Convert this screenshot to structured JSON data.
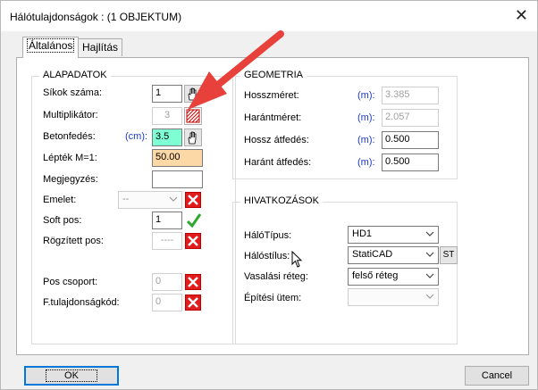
{
  "window": {
    "title": "Hálótulajdonságok : (1 OBJEKTUM)"
  },
  "tabs": [
    {
      "label": "Általános"
    },
    {
      "label": "Hajlítás"
    }
  ],
  "alapadatok": {
    "title": "ALAPADATOK",
    "sikok_label": "Síkok száma:",
    "sikok_value": "1",
    "multiplikator_label": "Multiplikátor:",
    "multiplikator_value": "3",
    "betonfedes_label": "Betonfedés:",
    "betonfedes_unit": "(cm):",
    "betonfedes_value": "3.5",
    "lepek_label": "Lépték M=1:",
    "lepek_value": "50.00",
    "megjegyzes_label": "Megjegyzés:",
    "megjegyzes_value": "",
    "emelet_label": "Emelet:",
    "emelet_value": "--",
    "soft_label": "Soft pos:",
    "soft_value": "1",
    "rogzitett_label": "Rögzített pos:",
    "rogzitett_value": "----",
    "pos_label": "Pos csoport:",
    "pos_value": "0",
    "ftul_label": "F.tulajdonságkód:",
    "ftul_value": "0"
  },
  "geometria": {
    "title": "GEOMETRIA",
    "hossz_label": "Hosszméret:",
    "hossz_unit": "(m):",
    "hossz_value": "3.385",
    "harant_label": "Harántméret:",
    "harant_unit": "(m):",
    "harant_value": "2.057",
    "hosszatf_label": "Hossz átfedés:",
    "hosszatf_unit": "(m):",
    "hosszatf_value": "0.500",
    "harantatf_label": "Haránt átfedés:",
    "harantatf_unit": "(m):",
    "harantatf_value": "0.500"
  },
  "hivatkozasok": {
    "title": "HIVATKOZÁSOK",
    "halotipus_label": "HálóTípus:",
    "halotipus_value": "HD1",
    "halostilus_label": "Hálóstílus:",
    "halostilus_value": "StatiCAD",
    "st_label": "ST",
    "vasalasi_label": "Vasalási réteg:",
    "vasalasi_value": "felső réteg",
    "epitesi_label": "Építési ütem:",
    "epitesi_value": ""
  },
  "buttons": {
    "ok": "OK",
    "cancel": "Cancel"
  },
  "colors": {
    "arrow": "#e8403a",
    "teal": "#7fffd4",
    "orange": "#fbd8a6",
    "red_x": "#e31b1b",
    "unit_blue": "#1a3ac9"
  },
  "icons": [
    "close-icon",
    "hand-icon",
    "hatch-icon",
    "red-x-icon",
    "green-check-icon",
    "chevron-down-icon",
    "cursor-icon",
    "arrow-annotation"
  ]
}
